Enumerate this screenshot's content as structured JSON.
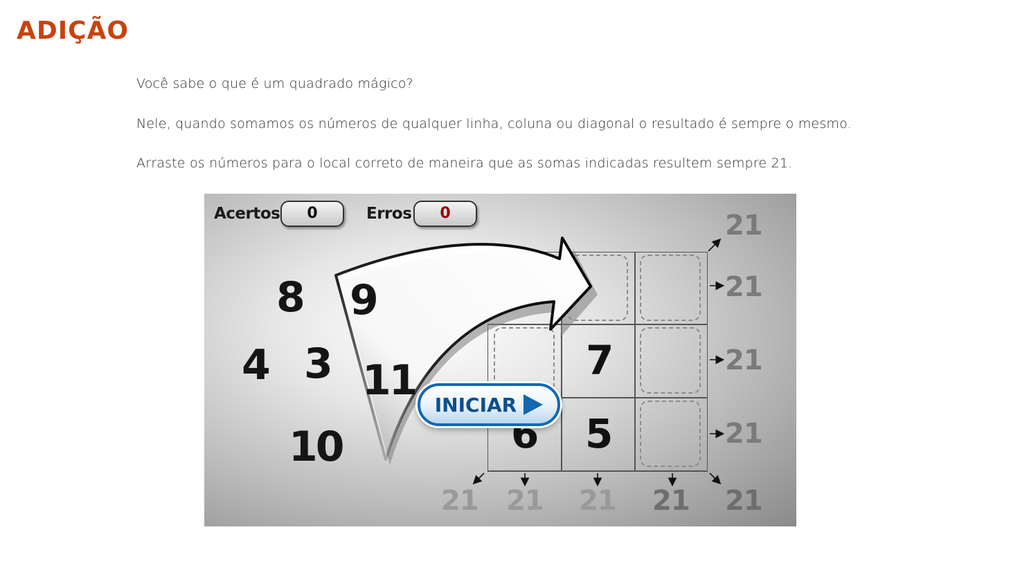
{
  "page": {
    "title": "ADIÇÃO",
    "paragraphs": [
      "Você sabe o que é um quadrado mágico?",
      "Nele, quando somamos os números de qualquer linha, coluna ou diagonal o resultado é sempre o mesmo.",
      "Arraste os números para o local correto de maneira que as somas indicadas resultem sempre 21."
    ]
  },
  "game": {
    "hud": {
      "hits_label": "Acertos",
      "hits_value": "0",
      "errors_label": "Erros",
      "errors_value": "0"
    },
    "tiles": [
      "8",
      "9",
      "4",
      "3",
      "11",
      "10"
    ],
    "grid": {
      "cells": [
        "",
        "",
        "",
        "",
        "7",
        "",
        "6",
        "5",
        ""
      ]
    },
    "sums": {
      "diagonal_top": "21",
      "rows": [
        "21",
        "21",
        "21"
      ],
      "diagonal_bottom_left": "21",
      "columns": [
        "21",
        "21",
        "21"
      ],
      "diagonal_bottom_right": "21"
    },
    "start_button": {
      "label": "INICIAR",
      "icon": "play-icon"
    },
    "colors": {
      "title": "#c9420f",
      "errors_value": "#9a0000",
      "button_border": "#1268b5",
      "button_text": "#0e4f8e"
    }
  }
}
